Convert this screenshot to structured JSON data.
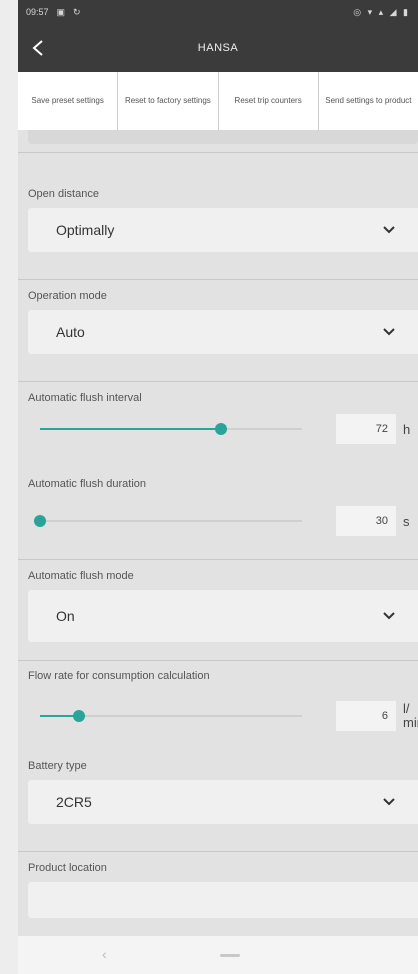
{
  "status_bar": {
    "time": "09:57",
    "icons_right": "◎ ▾ ▴ ◢ ▮"
  },
  "app_bar": {
    "title": "HANSA"
  },
  "actions": [
    {
      "label": "Save preset settings"
    },
    {
      "label": "Reset to factory settings"
    },
    {
      "label": "Reset trip counters"
    },
    {
      "label": "Send settings to product"
    }
  ],
  "open_distance": {
    "label": "Open distance",
    "value": "Optimally"
  },
  "operation_mode": {
    "label": "Operation mode",
    "value": "Auto"
  },
  "flush_interval": {
    "label": "Automatic flush interval",
    "value": "72",
    "unit": "h",
    "slider_fraction": 0.69
  },
  "flush_duration": {
    "label": "Automatic flush duration",
    "value": "30",
    "unit": "s",
    "slider_fraction": 0.0
  },
  "flush_mode": {
    "label": "Automatic flush mode",
    "value": "On"
  },
  "flow_rate": {
    "label": "Flow rate for consumption calculation",
    "value": "6",
    "unit": "l/\nmin",
    "slider_fraction": 0.15
  },
  "battery_type": {
    "label": "Battery type",
    "value": "2CR5"
  },
  "product_location": {
    "label": "Product location",
    "value": ""
  },
  "colors": {
    "accent": "#2aa39a",
    "bar": "#3b3b3b"
  },
  "icons": {
    "back": "chevron-left-icon",
    "dropdown": "chevron-down-icon"
  }
}
